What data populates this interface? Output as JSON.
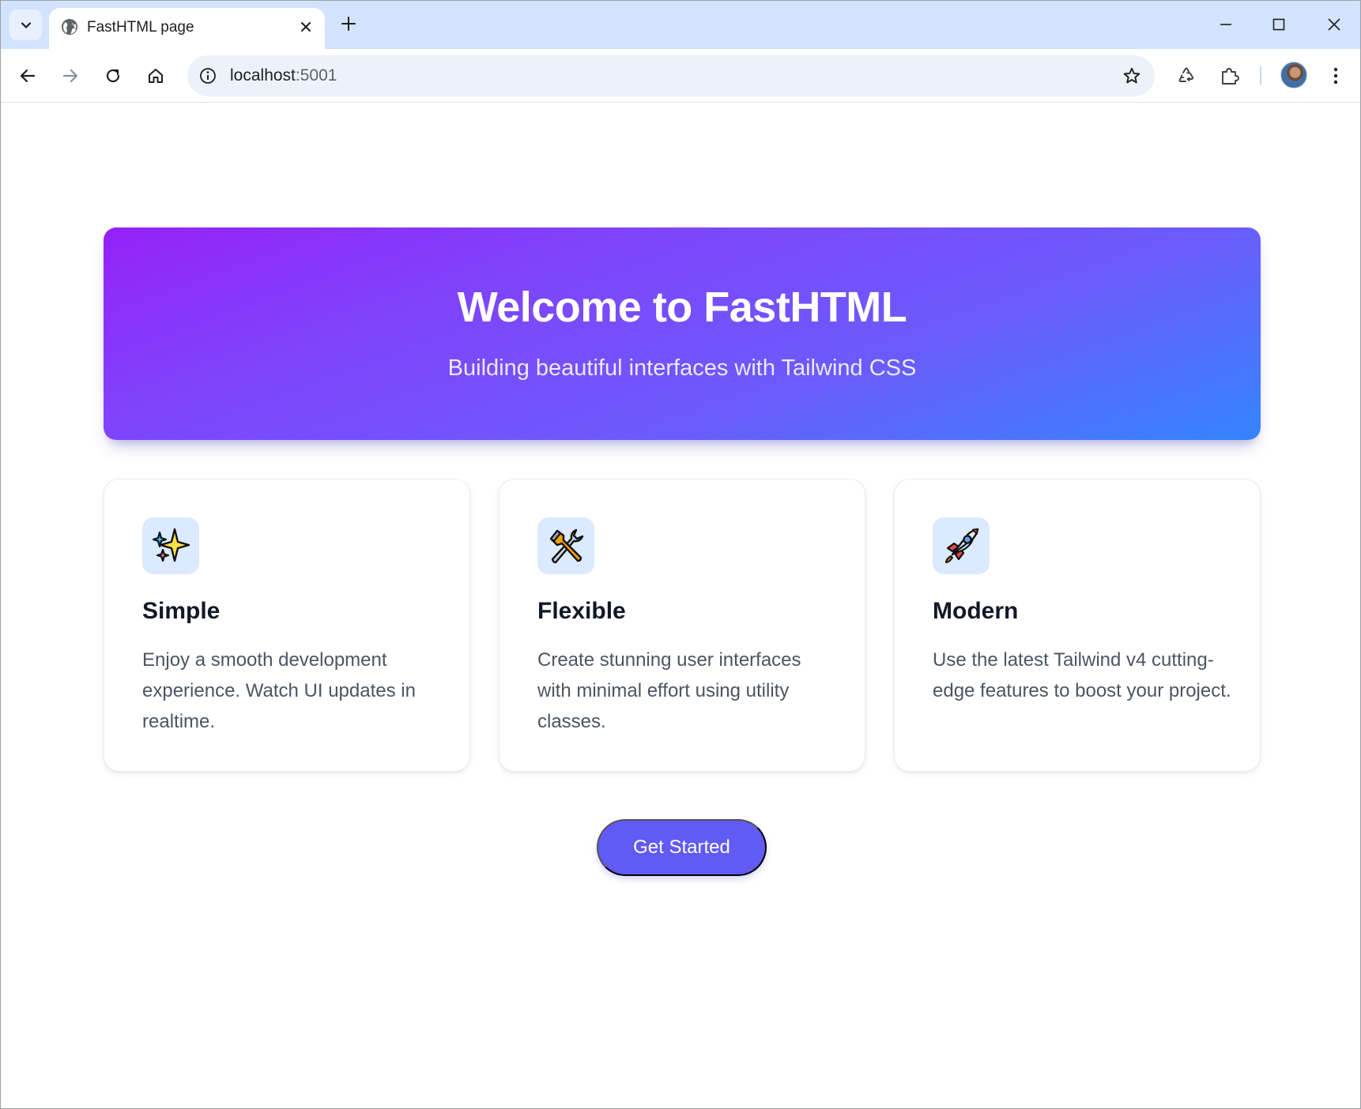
{
  "browser": {
    "tab_title": "FastHTML page",
    "url_host": "localhost",
    "url_port": ":5001"
  },
  "hero": {
    "title": "Welcome to FastHTML",
    "subtitle": "Building beautiful interfaces with Tailwind CSS"
  },
  "features": [
    {
      "icon": "sparkles-icon",
      "title": "Simple",
      "description": "Enjoy a smooth development experience. Watch UI updates in realtime."
    },
    {
      "icon": "tools-icon",
      "title": "Flexible",
      "description": "Create stunning user interfaces with minimal effort using utility classes."
    },
    {
      "icon": "rocket-icon",
      "title": "Modern",
      "description": "Use the latest Tailwind v4 cutting-edge features to boost your project."
    }
  ],
  "cta": {
    "label": "Get Started"
  },
  "colors": {
    "hero_gradient": [
      "#9521f8",
      "#8043fb",
      "#6b5bfc",
      "#3485fd"
    ],
    "cta": "#615af5",
    "icon_bg": "#dbeafe",
    "tabstrip": "#d3e3fd"
  }
}
